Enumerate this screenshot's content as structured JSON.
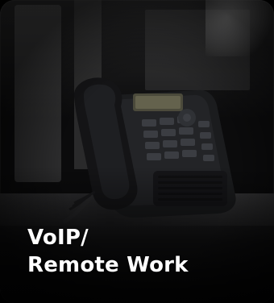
{
  "card": {
    "title_line1": "VoIP/",
    "title_line2": "Remote Work"
  },
  "colors": {
    "title_text": "#ffffff",
    "card_background": "#0b0b0c"
  },
  "image": {
    "subject": "desk-phone-icon"
  }
}
